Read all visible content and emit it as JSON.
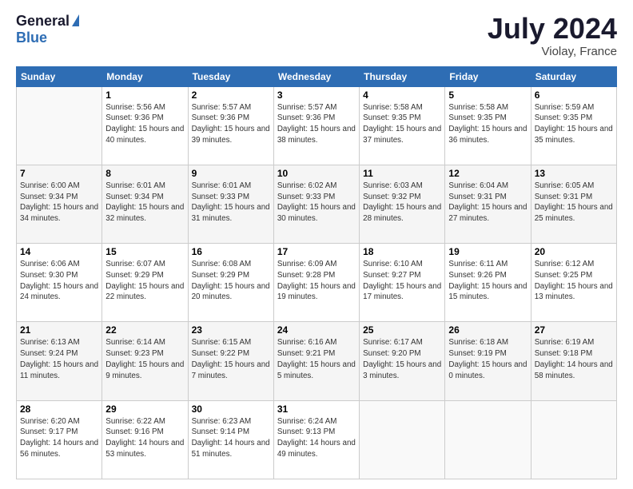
{
  "logo": {
    "general": "General",
    "blue": "Blue"
  },
  "title": "July 2024",
  "location": "Violay, France",
  "days_header": [
    "Sunday",
    "Monday",
    "Tuesday",
    "Wednesday",
    "Thursday",
    "Friday",
    "Saturday"
  ],
  "weeks": [
    [
      {
        "num": "",
        "sunrise": "",
        "sunset": "",
        "daylight": ""
      },
      {
        "num": "1",
        "sunrise": "Sunrise: 5:56 AM",
        "sunset": "Sunset: 9:36 PM",
        "daylight": "Daylight: 15 hours and 40 minutes."
      },
      {
        "num": "2",
        "sunrise": "Sunrise: 5:57 AM",
        "sunset": "Sunset: 9:36 PM",
        "daylight": "Daylight: 15 hours and 39 minutes."
      },
      {
        "num": "3",
        "sunrise": "Sunrise: 5:57 AM",
        "sunset": "Sunset: 9:36 PM",
        "daylight": "Daylight: 15 hours and 38 minutes."
      },
      {
        "num": "4",
        "sunrise": "Sunrise: 5:58 AM",
        "sunset": "Sunset: 9:35 PM",
        "daylight": "Daylight: 15 hours and 37 minutes."
      },
      {
        "num": "5",
        "sunrise": "Sunrise: 5:58 AM",
        "sunset": "Sunset: 9:35 PM",
        "daylight": "Daylight: 15 hours and 36 minutes."
      },
      {
        "num": "6",
        "sunrise": "Sunrise: 5:59 AM",
        "sunset": "Sunset: 9:35 PM",
        "daylight": "Daylight: 15 hours and 35 minutes."
      }
    ],
    [
      {
        "num": "7",
        "sunrise": "Sunrise: 6:00 AM",
        "sunset": "Sunset: 9:34 PM",
        "daylight": "Daylight: 15 hours and 34 minutes."
      },
      {
        "num": "8",
        "sunrise": "Sunrise: 6:01 AM",
        "sunset": "Sunset: 9:34 PM",
        "daylight": "Daylight: 15 hours and 32 minutes."
      },
      {
        "num": "9",
        "sunrise": "Sunrise: 6:01 AM",
        "sunset": "Sunset: 9:33 PM",
        "daylight": "Daylight: 15 hours and 31 minutes."
      },
      {
        "num": "10",
        "sunrise": "Sunrise: 6:02 AM",
        "sunset": "Sunset: 9:33 PM",
        "daylight": "Daylight: 15 hours and 30 minutes."
      },
      {
        "num": "11",
        "sunrise": "Sunrise: 6:03 AM",
        "sunset": "Sunset: 9:32 PM",
        "daylight": "Daylight: 15 hours and 28 minutes."
      },
      {
        "num": "12",
        "sunrise": "Sunrise: 6:04 AM",
        "sunset": "Sunset: 9:31 PM",
        "daylight": "Daylight: 15 hours and 27 minutes."
      },
      {
        "num": "13",
        "sunrise": "Sunrise: 6:05 AM",
        "sunset": "Sunset: 9:31 PM",
        "daylight": "Daylight: 15 hours and 25 minutes."
      }
    ],
    [
      {
        "num": "14",
        "sunrise": "Sunrise: 6:06 AM",
        "sunset": "Sunset: 9:30 PM",
        "daylight": "Daylight: 15 hours and 24 minutes."
      },
      {
        "num": "15",
        "sunrise": "Sunrise: 6:07 AM",
        "sunset": "Sunset: 9:29 PM",
        "daylight": "Daylight: 15 hours and 22 minutes."
      },
      {
        "num": "16",
        "sunrise": "Sunrise: 6:08 AM",
        "sunset": "Sunset: 9:29 PM",
        "daylight": "Daylight: 15 hours and 20 minutes."
      },
      {
        "num": "17",
        "sunrise": "Sunrise: 6:09 AM",
        "sunset": "Sunset: 9:28 PM",
        "daylight": "Daylight: 15 hours and 19 minutes."
      },
      {
        "num": "18",
        "sunrise": "Sunrise: 6:10 AM",
        "sunset": "Sunset: 9:27 PM",
        "daylight": "Daylight: 15 hours and 17 minutes."
      },
      {
        "num": "19",
        "sunrise": "Sunrise: 6:11 AM",
        "sunset": "Sunset: 9:26 PM",
        "daylight": "Daylight: 15 hours and 15 minutes."
      },
      {
        "num": "20",
        "sunrise": "Sunrise: 6:12 AM",
        "sunset": "Sunset: 9:25 PM",
        "daylight": "Daylight: 15 hours and 13 minutes."
      }
    ],
    [
      {
        "num": "21",
        "sunrise": "Sunrise: 6:13 AM",
        "sunset": "Sunset: 9:24 PM",
        "daylight": "Daylight: 15 hours and 11 minutes."
      },
      {
        "num": "22",
        "sunrise": "Sunrise: 6:14 AM",
        "sunset": "Sunset: 9:23 PM",
        "daylight": "Daylight: 15 hours and 9 minutes."
      },
      {
        "num": "23",
        "sunrise": "Sunrise: 6:15 AM",
        "sunset": "Sunset: 9:22 PM",
        "daylight": "Daylight: 15 hours and 7 minutes."
      },
      {
        "num": "24",
        "sunrise": "Sunrise: 6:16 AM",
        "sunset": "Sunset: 9:21 PM",
        "daylight": "Daylight: 15 hours and 5 minutes."
      },
      {
        "num": "25",
        "sunrise": "Sunrise: 6:17 AM",
        "sunset": "Sunset: 9:20 PM",
        "daylight": "Daylight: 15 hours and 3 minutes."
      },
      {
        "num": "26",
        "sunrise": "Sunrise: 6:18 AM",
        "sunset": "Sunset: 9:19 PM",
        "daylight": "Daylight: 15 hours and 0 minutes."
      },
      {
        "num": "27",
        "sunrise": "Sunrise: 6:19 AM",
        "sunset": "Sunset: 9:18 PM",
        "daylight": "Daylight: 14 hours and 58 minutes."
      }
    ],
    [
      {
        "num": "28",
        "sunrise": "Sunrise: 6:20 AM",
        "sunset": "Sunset: 9:17 PM",
        "daylight": "Daylight: 14 hours and 56 minutes."
      },
      {
        "num": "29",
        "sunrise": "Sunrise: 6:22 AM",
        "sunset": "Sunset: 9:16 PM",
        "daylight": "Daylight: 14 hours and 53 minutes."
      },
      {
        "num": "30",
        "sunrise": "Sunrise: 6:23 AM",
        "sunset": "Sunset: 9:14 PM",
        "daylight": "Daylight: 14 hours and 51 minutes."
      },
      {
        "num": "31",
        "sunrise": "Sunrise: 6:24 AM",
        "sunset": "Sunset: 9:13 PM",
        "daylight": "Daylight: 14 hours and 49 minutes."
      },
      {
        "num": "",
        "sunrise": "",
        "sunset": "",
        "daylight": ""
      },
      {
        "num": "",
        "sunrise": "",
        "sunset": "",
        "daylight": ""
      },
      {
        "num": "",
        "sunrise": "",
        "sunset": "",
        "daylight": ""
      }
    ]
  ]
}
